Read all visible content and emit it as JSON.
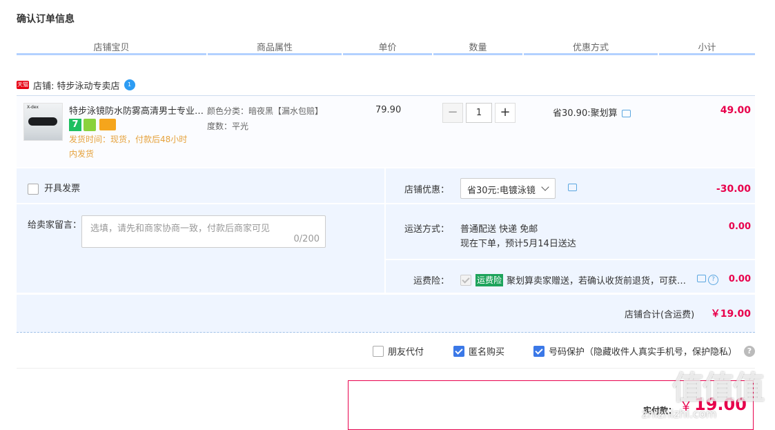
{
  "page_title": "确认订单信息",
  "table_headers": [
    "店铺宝贝",
    "商品属性",
    "单价",
    "数量",
    "优惠方式",
    "小计"
  ],
  "shop": {
    "badge": "天猫",
    "label": "店铺: 特步泳动专卖店",
    "chat_badge": "1"
  },
  "item": {
    "thumb_brand": "X-dex",
    "name": "特步泳镜防水防雾高清男士专业…",
    "badge_7": "7",
    "ship_line1": "发货时间：现货，付款后48小时",
    "ship_line2": "内发货",
    "attr_color": "颜色分类：暗夜黑【漏水包赔】",
    "attr_degree": "度数：平光",
    "price": "79.90",
    "quantity": "1",
    "minus": "−",
    "plus": "+",
    "promo": "省30.90:聚划算",
    "subtotal": "49.00"
  },
  "invoice_label": "开具发票",
  "message": {
    "label": "给卖家留言：",
    "placeholder": "选填，请先和商家协商一致，付款后商家可见",
    "count": "0/200"
  },
  "store_discount": {
    "label": "店铺优惠：",
    "selected": "省30元:电镀泳镜",
    "amount": "-30.00"
  },
  "shipping": {
    "label": "运送方式：",
    "method": "普通配送 快递 免邮",
    "eta": "现在下单，预计5月14日送达",
    "amount": "0.00"
  },
  "insurance": {
    "label": "运费险：",
    "tag": "运费险",
    "text": "聚划算卖家赠送，若确认收货前退货，可获…",
    "help": "?",
    "amount": "0.00"
  },
  "store_total": {
    "label": "店铺合计(含运费)",
    "amount": "￥19.00"
  },
  "options": {
    "friend_pay": "朋友代付",
    "anonymous": "匿名购买",
    "number_protect": "号码保护（隐藏收件人真实手机号，保护隐私）",
    "help": "?"
  },
  "payment": {
    "label": "实付款：",
    "currency": "￥",
    "amount": "19.00"
  },
  "watermark": {
    "big": "值值值",
    "small": "zhizhizhi.com"
  },
  "colors": {
    "accent_red": "#e8004c",
    "header_line": "#b2d1ff",
    "panel_bg": "#eff5ff",
    "ship_orange": "#e6a23c"
  }
}
